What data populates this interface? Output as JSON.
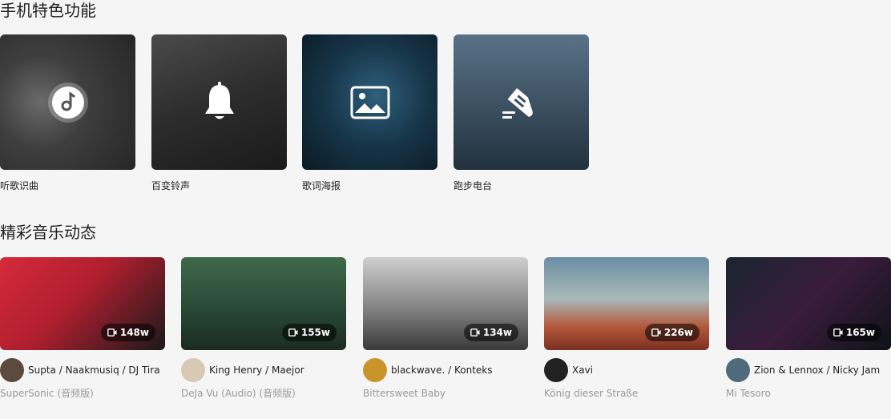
{
  "sections": {
    "features_title": "手机特色功能",
    "dynamics_title": "精彩音乐动态"
  },
  "features": [
    {
      "label": "听歌识曲",
      "icon": "music-note-icon"
    },
    {
      "label": "百变铃声",
      "icon": "bell-icon"
    },
    {
      "label": "歌词海报",
      "icon": "image-icon"
    },
    {
      "label": "跑步电台",
      "icon": "running-shoe-icon"
    }
  ],
  "dynamics": [
    {
      "views": "148w",
      "author": "Supta / Naakmusiq / DJ Tira",
      "song": "SuperSonic (音频版)"
    },
    {
      "views": "155w",
      "author": "King Henry / Maejor",
      "song": "DeJa Vu (Audio) (音频版)"
    },
    {
      "views": "134w",
      "author": "blackwave. / Konteks",
      "song": "Bittersweet Baby"
    },
    {
      "views": "226w",
      "author": "Xavi",
      "song": "König dieser Straße"
    },
    {
      "views": "165w",
      "author": "Zion & Lennox / Nicky Jam",
      "song": "Mi Tesoro"
    }
  ]
}
